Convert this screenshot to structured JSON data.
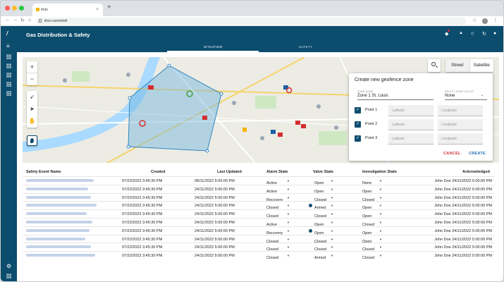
{
  "browser": {
    "tab_title": "Itron",
    "tab_close": "×",
    "new_tab": "+",
    "url": "itron.com/shell",
    "star": "☆",
    "menu": "⋮"
  },
  "app": {
    "title": "Gas Distribution & Safety",
    "tabs": [
      {
        "label": "SITUATION",
        "active": true
      },
      {
        "label": "SAFETY",
        "active": false
      }
    ],
    "accent": "#0c4d6e"
  },
  "map": {
    "zoom_in": "+",
    "zoom_out": "−",
    "view_options": [
      "Street",
      "Satellite"
    ],
    "selected_view": "Street"
  },
  "geofence": {
    "title": "Create new geofence zone",
    "zone_name_label": "ZONE NAME",
    "zone_name_value": "Zone 1 St. Louis",
    "zone_color_label": "SELECT ZONE COLOR",
    "zone_color_value": "None",
    "points": [
      {
        "label": "Point 1",
        "checked": true,
        "latitude_placeholder": "Latitude",
        "longitude_placeholder": "Longitude"
      },
      {
        "label": "Point 2",
        "checked": true,
        "latitude_placeholder": "Latitude",
        "longitude_placeholder": "Longitude"
      },
      {
        "label": "Point 3",
        "checked": true,
        "latitude_placeholder": "Latitude",
        "longitude_placeholder": "Longitude"
      }
    ],
    "cancel_label": "CANCEL",
    "create_label": "CREATE"
  },
  "table": {
    "headers": {
      "name": "Safety Event Name",
      "created": "Created",
      "updated": "Last Updated",
      "alarm": "Alarm State",
      "valve": "Valve State",
      "investigation": "Investigation State",
      "ack": "Acknowledged"
    },
    "rows": [
      {
        "created": "07/22/2022 3:45:30 PM",
        "updated": "08/11/2022 5:00:00 PM",
        "alarm": "Active",
        "valve": "Open",
        "valve_info": false,
        "investigation": "None",
        "ack": "John Doe 24/11/2022 5:00:00 PM"
      },
      {
        "created": "07/22/2022 3:45:30 PM",
        "updated": "24/11/2022 5:00:00 PM",
        "alarm": "Active",
        "valve": "Open",
        "valve_info": false,
        "investigation": "Open",
        "ack": "John Doe 24/11/2022 5:00:00 PM"
      },
      {
        "created": "07/22/2022 3:45:30 PM",
        "updated": "24/11/2022 5:00:00 PM",
        "alarm": "Recovery",
        "valve": "Closed",
        "valve_info": false,
        "investigation": "Closed",
        "ack": "John Doe 24/11/2022 5:00:00 PM"
      },
      {
        "created": "07/22/2022 3:45:30 PM",
        "updated": "24/11/2022 5:00:00 PM",
        "alarm": "Closed",
        "valve": "Armed",
        "valve_info": true,
        "investigation": "Open",
        "ack": "John Doe 24/11/2022 5:00:00 PM"
      },
      {
        "created": "07/22/2022 3:45:30 PM",
        "updated": "24/11/2022 5:00:00 PM",
        "alarm": "Closed",
        "valve": "Closed",
        "valve_info": false,
        "investigation": "Open",
        "ack": "John Doe 24/11/2022 5:00:00 PM"
      },
      {
        "created": "07/22/2022 3:45:30 PM",
        "updated": "24/11/2022 5:00:00 PM",
        "alarm": "Active",
        "valve": "Open",
        "valve_info": false,
        "investigation": "Closed",
        "ack": "John Doe 24/11/2022 5:00:00 PM"
      },
      {
        "created": "07/22/2022 3:45:30 PM",
        "updated": "24/11/2022 5:00:00 PM",
        "alarm": "Recovery",
        "valve": "Open",
        "valve_info": true,
        "investigation": "Open",
        "ack": "John Doe 24/11/2022 5:00:00 PM"
      },
      {
        "created": "07/22/2022 3:45:30 PM",
        "updated": "24/11/2022 5:00:00 PM",
        "alarm": "Closed",
        "valve": "Closed",
        "valve_info": false,
        "investigation": "Open",
        "ack": "John Doe 24/11/2022 5:00:00 PM"
      },
      {
        "created": "07/22/2022 3:45:30 PM",
        "updated": "24/11/2022 5:00:00 PM",
        "alarm": "Closed",
        "valve": "Closed",
        "valve_info": false,
        "investigation": "Closed",
        "ack": "John Doe 24/11/2022 5:00:00 PM"
      },
      {
        "created": "07/22/2022 3:45:30 PM",
        "updated": "24/11/2022 5:00:00 PM",
        "alarm": "Closed",
        "valve": "Armed",
        "valve_info": false,
        "investigation": "Closed",
        "ack": "John Doe 24/11/2022 5:00:00 PM"
      }
    ]
  }
}
